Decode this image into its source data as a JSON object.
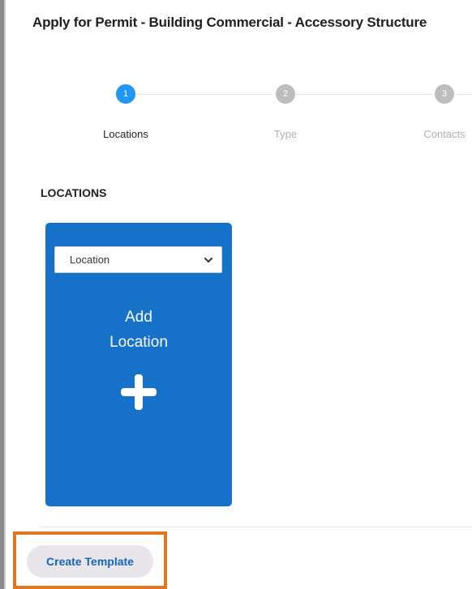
{
  "page": {
    "title": "Apply for Permit - Building Commercial - Accessory Structure"
  },
  "stepper": {
    "steps": [
      {
        "number": "1",
        "label": "Locations",
        "state": "active"
      },
      {
        "number": "2",
        "label": "Type",
        "state": "inactive"
      },
      {
        "number": "3",
        "label": "Contacts",
        "state": "inactive"
      }
    ]
  },
  "locations": {
    "heading": "LOCATIONS",
    "card": {
      "select_value": "Location",
      "add_line1": "Add",
      "add_line2": "Location",
      "icon": "plus-icon"
    }
  },
  "footer": {
    "create_template_label": "Create Template"
  },
  "colors": {
    "accent": "#2196f3",
    "card": "#1672c9",
    "highlight": "#e2751f",
    "button_text": "#1565c0"
  }
}
